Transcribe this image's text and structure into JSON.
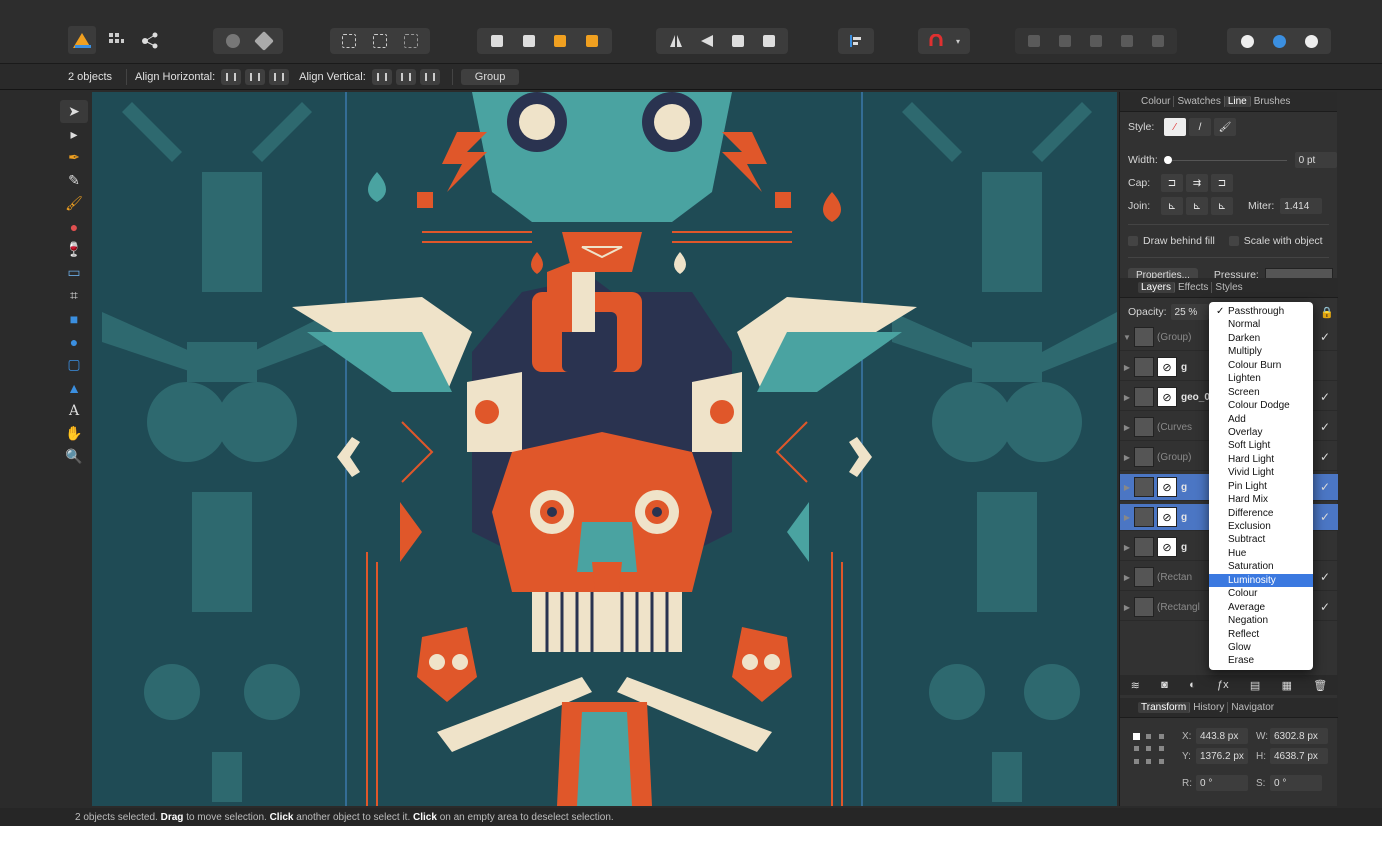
{
  "context_bar": {
    "selection_count": "2 objects",
    "align_horizontal_label": "Align Horizontal:",
    "align_vertical_label": "Align Vertical:",
    "group_label": "Group"
  },
  "panel_top": {
    "tabs": [
      "Colour",
      "Swatches",
      "Line",
      "Brushes"
    ],
    "active_tab": "Line",
    "style_label": "Style:",
    "width_label": "Width:",
    "width_value": "0 pt",
    "cap_label": "Cap:",
    "join_label": "Join:",
    "miter_label": "Miter:",
    "miter_value": "1.414",
    "draw_behind_fill": "Draw behind fill",
    "scale_with_object": "Scale with object",
    "properties_btn": "Properties...",
    "pressure_label": "Pressure:"
  },
  "layers_panel": {
    "tabs": [
      "Layers",
      "Effects",
      "Styles"
    ],
    "active_tab": "Layers",
    "opacity_label": "Opacity:",
    "opacity_value": "25 %",
    "layers": [
      {
        "name": "(Group)",
        "dim": true,
        "selected": false,
        "visible": true
      },
      {
        "name": "g",
        "dim": false,
        "selected": false,
        "visible": false
      },
      {
        "name": "geo_01",
        "dim": false,
        "selected": false,
        "visible": true
      },
      {
        "name": "(Curves",
        "dim": true,
        "selected": false,
        "visible": true
      },
      {
        "name": "(Group)",
        "dim": true,
        "selected": false,
        "visible": true
      },
      {
        "name": "g",
        "dim": false,
        "selected": true,
        "visible": true
      },
      {
        "name": "g",
        "dim": false,
        "selected": true,
        "visible": true
      },
      {
        "name": "g",
        "dim": false,
        "selected": false,
        "visible": false
      },
      {
        "name": "(Rectan",
        "dim": true,
        "selected": false,
        "visible": true
      },
      {
        "name": "(Rectangl",
        "dim": true,
        "selected": false,
        "visible": true
      }
    ]
  },
  "blend_modes": {
    "checked": "Passthrough",
    "highlighted": "Luminosity",
    "items": [
      "Passthrough",
      "Normal",
      "Darken",
      "Multiply",
      "Colour Burn",
      "Lighten",
      "Screen",
      "Colour Dodge",
      "Add",
      "Overlay",
      "Soft Light",
      "Hard Light",
      "Vivid Light",
      "Pin Light",
      "Hard Mix",
      "Difference",
      "Exclusion",
      "Subtract",
      "Hue",
      "Saturation",
      "Luminosity",
      "Colour",
      "Average",
      "Negation",
      "Reflect",
      "Glow",
      "Erase"
    ]
  },
  "transform_panel": {
    "tabs": [
      "Transform",
      "History",
      "Navigator"
    ],
    "active_tab": "Transform",
    "x_label": "X:",
    "x_value": "443.8 px",
    "y_label": "Y:",
    "y_value": "1376.2 px",
    "w_label": "W:",
    "w_value": "6302.8 px",
    "h_label": "H:",
    "h_value": "4638.7 px",
    "r_label": "R:",
    "r_value": "0 °",
    "s_label": "S:",
    "s_value": "0 °"
  },
  "status": {
    "part1": "2 objects selected.",
    "drag": "Drag",
    "part2": "to move selection.",
    "click1": "Click",
    "part3": "another object to select it.",
    "click2": "Click",
    "part4": "on an empty area to deselect selection."
  },
  "colors": {
    "canvas_bg": "#1f4b55",
    "art_orange": "#e0572a",
    "art_teal": "#4aa3a1",
    "art_cream": "#efe3c9",
    "art_navy": "#2a3350",
    "selection": "#4b76c4",
    "menu_highlight": "#3b79e0"
  }
}
